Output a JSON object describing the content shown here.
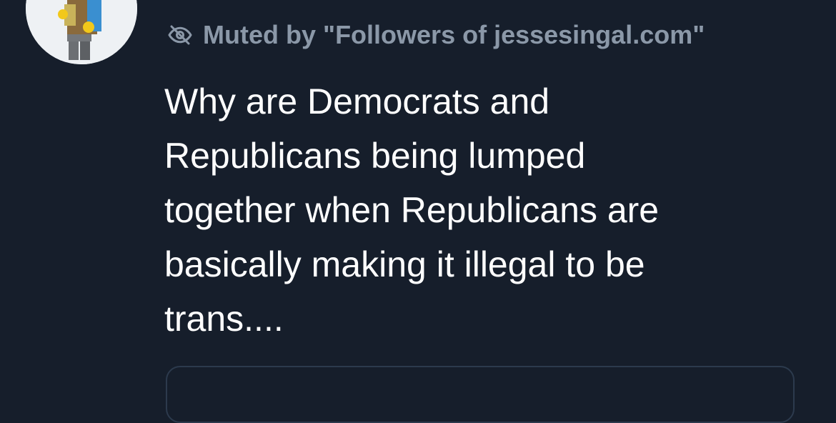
{
  "post": {
    "muted_label": "Muted by \"Followers of jessesingal.com\"",
    "text": "Why are Democrats and\nRepublicans being lumped\ntogether when Republicans are\nbasically making it illegal to be\ntrans....",
    "avatar_icon": "lego-minifigure-avatar",
    "muted_icon": "eye-slash-icon"
  },
  "colors": {
    "background": "#161e2b",
    "muted_text": "#8b98a8",
    "post_text": "#ffffff"
  }
}
